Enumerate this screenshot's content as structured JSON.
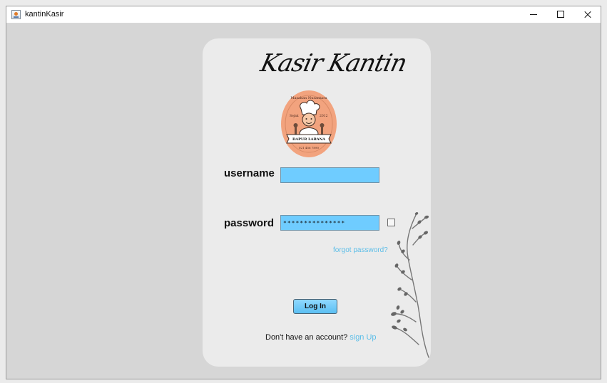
{
  "window": {
    "title": "kantinKasir"
  },
  "login": {
    "brand_title": "Kasir Kantin",
    "logo_text": {
      "top": "Masakan Nusantara",
      "sejak": "Sejak",
      "year": "2012",
      "name": "DAPUR LARANA",
      "phone": "021 456 7890"
    },
    "username_label": "username",
    "username_value": "",
    "password_label": "password",
    "password_value": "***************",
    "forgot_password": "forgot password?",
    "login_button": "Log In",
    "signup_prompt": "Don't have an account?",
    "signup_link": "sign Up"
  },
  "colors": {
    "background": "#d6d6d6",
    "card": "#ebebeb",
    "input_fill": "#6fccff",
    "link": "#5dbee8",
    "logo_peach": "#f2a37e"
  },
  "icons": {
    "app": "java-app-icon",
    "minimize": "minimize-icon",
    "maximize": "maximize-icon",
    "close": "close-icon",
    "logo": "chef-logo-icon",
    "plant": "plant-decoration-icon"
  }
}
